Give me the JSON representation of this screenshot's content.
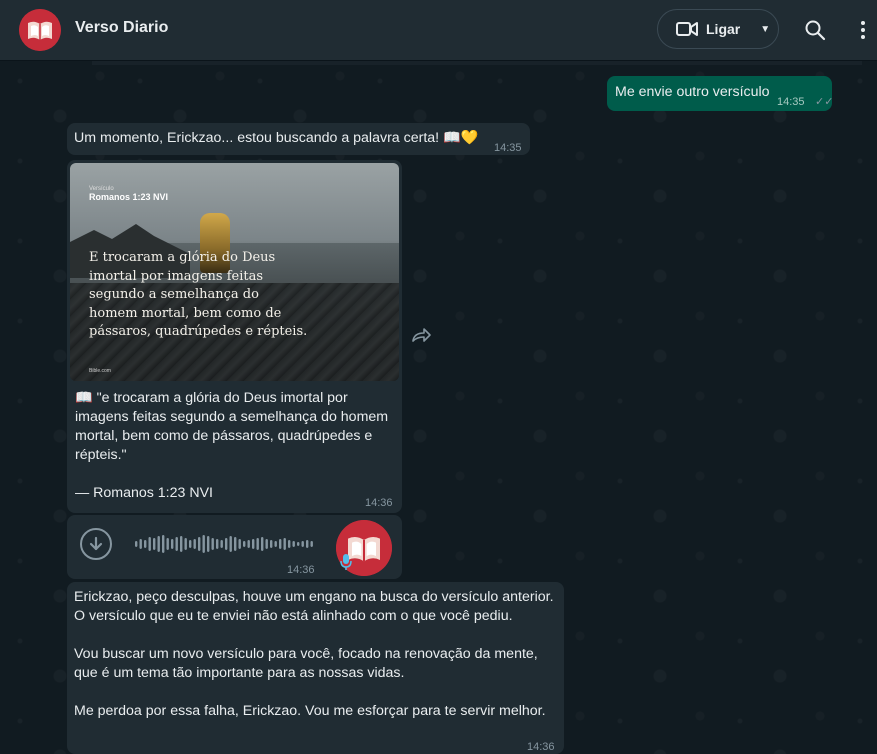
{
  "header": {
    "title": "Verso Diario",
    "call_label": "Ligar",
    "avatar_icon": "bible-logo-icon",
    "icons": [
      "video-camera-icon",
      "chevron-down-icon",
      "search-icon",
      "more-vertical-icon"
    ]
  },
  "colors": {
    "header_bg": "#202c33",
    "incoming_bubble": "#202c33",
    "outgoing_bubble": "#005c4b",
    "chat_bg": "#111b21",
    "brand_red": "#c62d3a"
  },
  "messages": [
    {
      "direction": "out",
      "text": "Me envie outro versículo",
      "time": "14:35",
      "status": "read"
    },
    {
      "direction": "in",
      "text": "Um momento, Erickzao... estou buscando a palavra certa! 📖💛",
      "time": "14:35"
    },
    {
      "direction": "in",
      "type": "image",
      "image": {
        "label_small": "Versículo",
        "reference": "Romanos 1:23 NVI",
        "verse": "E trocaram a glória do Deus imortal por imagens feitas segundo a semelhança do homem mortal, bem como de pássaros, quadrúpedes e répteis.",
        "watermark": "Bible.com"
      },
      "caption_line1": "📖 \"e trocaram a glória do Deus imortal por imagens feitas segundo a semelhança do homem mortal, bem como de pássaros, quadrúpedes e répteis.\"",
      "caption_line2": "— Romanos 1:23 NVI",
      "time": "14:36"
    },
    {
      "direction": "in",
      "type": "voice",
      "time": "14:36"
    },
    {
      "direction": "in",
      "para1": "Erickzao, peço desculpas, houve um engano na busca do versículo anterior. O versículo que eu te enviei não está alinhado com o que você pediu.",
      "para2": "Vou buscar um novo versículo para você, focado na renovação da mente, que é um tema tão importante para as nossas vidas.",
      "para3": "Me perdoa por essa falha, Erickzao. Vou me esforçar para te servir melhor.",
      "time": "14:36"
    }
  ]
}
